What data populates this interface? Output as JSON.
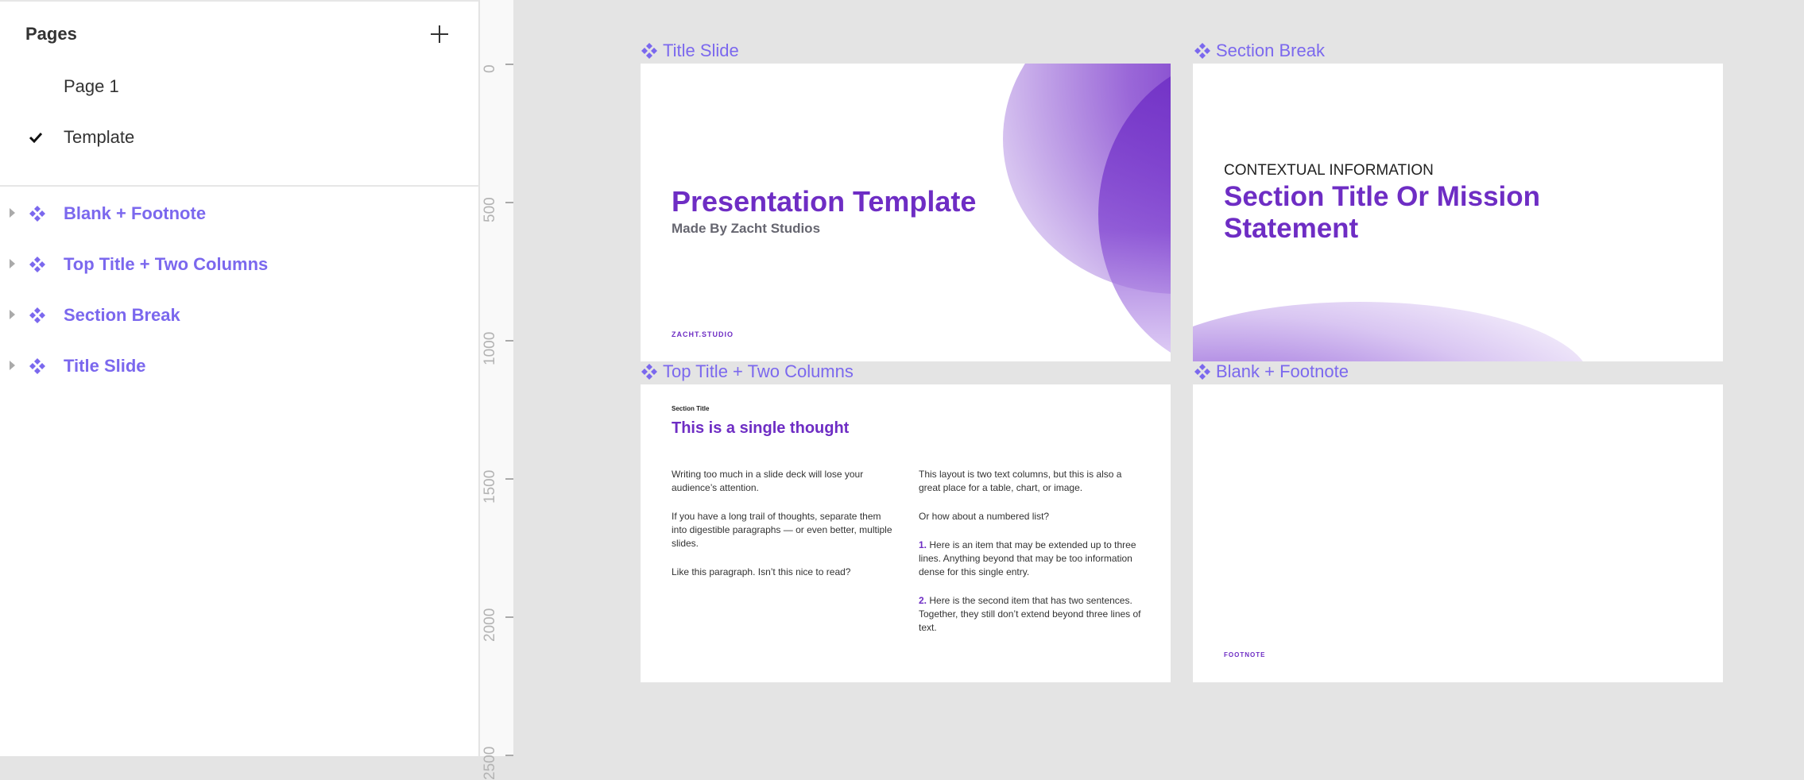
{
  "pages_panel": {
    "title": "Pages",
    "add_icon": "plus-icon",
    "pages": [
      {
        "label": "Page 1",
        "selected": false
      },
      {
        "label": "Template",
        "selected": true
      }
    ]
  },
  "layers": [
    {
      "label": "Blank + Footnote",
      "icon": "component-icon"
    },
    {
      "label": "Top Title + Two Columns",
      "icon": "component-icon"
    },
    {
      "label": "Section Break",
      "icon": "component-icon"
    },
    {
      "label": "Title Slide",
      "icon": "component-icon"
    }
  ],
  "ruler": {
    "labels": [
      "0",
      "500",
      "1000",
      "1500",
      "2000",
      "2500"
    ]
  },
  "colors": {
    "component_accent": "#7b68ee",
    "brand_purple": "#6e2dc4"
  },
  "frames": {
    "title_slide": {
      "label": "Title Slide",
      "title": "Presentation Template",
      "subtitle": "Made By Zacht Studios",
      "footer": "ZACHT.STUDIO"
    },
    "section_break": {
      "label": "Section Break",
      "context": "CONTEXTUAL INFORMATION",
      "title": "Section Title Or Mission Statement"
    },
    "two_columns": {
      "label": "Top Title + Two Columns",
      "section": "Section Title",
      "title": "This is a single thought",
      "left": [
        "Writing too much in a slide deck will lose your audience’s attention.",
        "If you have a long trail of thoughts, separate them into digestible paragraphs — or even better, multiple slides.",
        "Like this paragraph. Isn’t this nice to read?"
      ],
      "right_intro": [
        "This layout is two text columns, but this is also a great place for a table, chart, or image.",
        "Or how about a numbered list?"
      ],
      "list": [
        {
          "num": "1.",
          "text": " Here is an item that may be extended up to three lines. Anything beyond that may be too information dense for this single entry."
        },
        {
          "num": "2.",
          "text": " Here is the second item that has two sentences. Together, they still don’t extend beyond three lines of text."
        }
      ]
    },
    "blank_footnote": {
      "label": "Blank + Footnote",
      "footer": "FOOTNOTE"
    }
  }
}
